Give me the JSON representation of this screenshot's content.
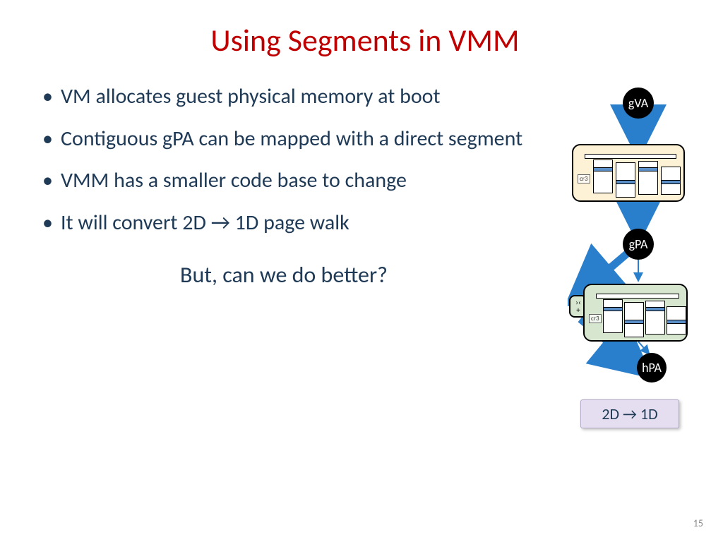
{
  "title": "Using Segments in VMM",
  "bullets": [
    "VM allocates guest physical memory at boot",
    "Contiguous gPA can be mapped with a direct segment",
    "VMM has a smaller code base to change",
    "It will convert 2D → 1D page walk"
  ],
  "question": "But, can we do better?",
  "diagram": {
    "nodes": {
      "gva": "gVA",
      "gpa": "gPA",
      "hpa": "hPA"
    },
    "cr3": "cr3",
    "direct_symbol_top": "›‹",
    "direct_symbol_bot": "+",
    "badge": "2D → 1D"
  },
  "page_number": "15"
}
